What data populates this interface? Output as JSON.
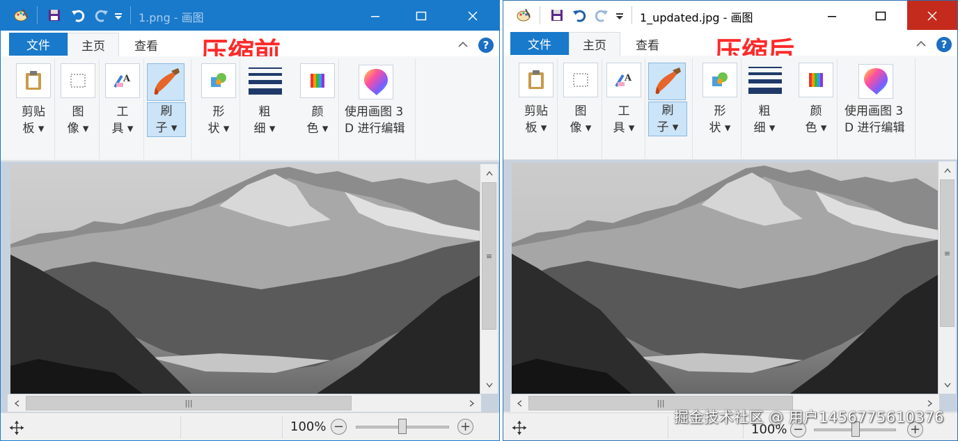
{
  "left_window": {
    "title": "1.png - 画图",
    "tabs": {
      "file": "文件",
      "home": "主页",
      "view": "查看"
    },
    "annotation": "压缩前",
    "ribbon": {
      "clipboard": [
        "剪贴",
        "板 ▾"
      ],
      "image": [
        "图",
        "像 ▾"
      ],
      "tools": [
        "工",
        "具 ▾"
      ],
      "brush": [
        "刷",
        "子 ▾"
      ],
      "shapes": [
        "形",
        "状 ▾"
      ],
      "size": [
        "粗",
        "细 ▾"
      ],
      "colors": [
        "颜",
        "色 ▾"
      ],
      "paint3d": [
        "使用画图 3",
        "D 进行编辑"
      ]
    },
    "zoom": "100%",
    "zoom_level_percent": 100
  },
  "right_window": {
    "title": "1_updated.jpg - 画图",
    "tabs": {
      "file": "文件",
      "home": "主页",
      "view": "查看"
    },
    "annotation": "压缩后",
    "ribbon": {
      "clipboard": [
        "剪贴",
        "板 ▾"
      ],
      "image": [
        "图",
        "像 ▾"
      ],
      "tools": [
        "工",
        "具 ▾"
      ],
      "brush": [
        "刷",
        "子 ▾"
      ],
      "shapes": [
        "形",
        "状 ▾"
      ],
      "size": [
        "粗",
        "细 ▾"
      ],
      "colors": [
        "颜",
        "色 ▾"
      ],
      "paint3d": [
        "使用画图 3",
        "D 进行编辑"
      ]
    },
    "zoom": "100%",
    "zoom_level_percent": 100
  },
  "watermark": "掘金技术社区 @ 用户1456775610376"
}
